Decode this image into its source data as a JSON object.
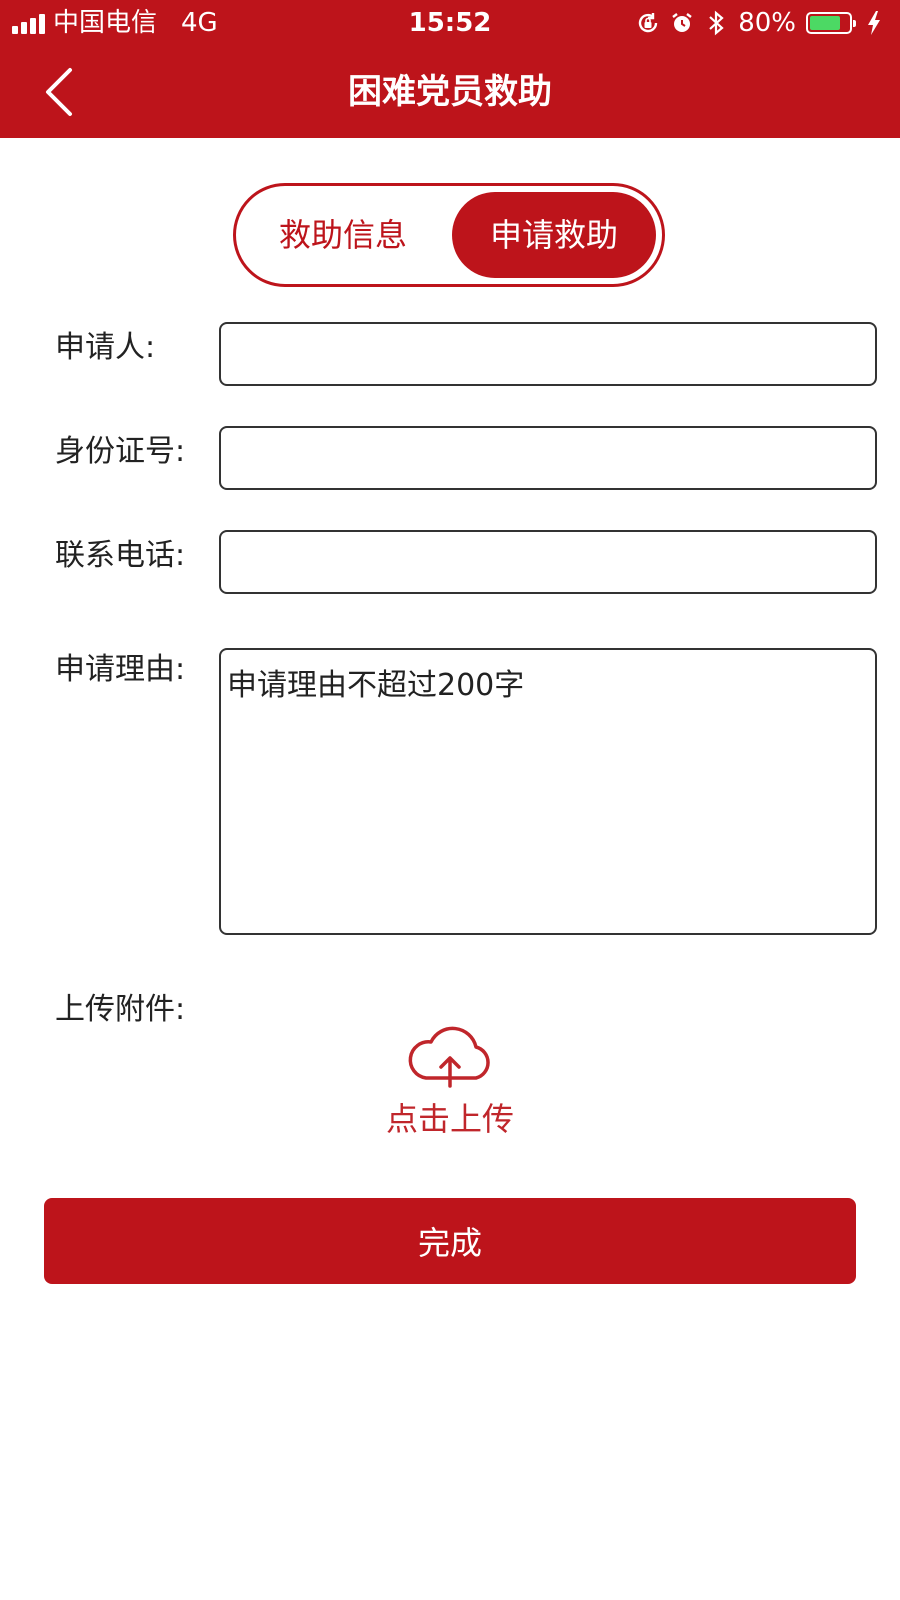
{
  "status_bar": {
    "carrier": "中国电信",
    "network": "4G",
    "time": "15:52",
    "battery": "80%",
    "battery_level": 0.8,
    "icons": [
      "signal-icon",
      "rotation-lock-icon",
      "alarm-icon",
      "bluetooth-icon",
      "battery-icon",
      "charging-icon"
    ]
  },
  "nav": {
    "title": "困难党员救助",
    "back_icon": "chevron-left-icon"
  },
  "segment": {
    "tabs": [
      {
        "label": "救助信息",
        "active": false
      },
      {
        "label": "申请救助",
        "active": true
      }
    ]
  },
  "form": {
    "applicant": {
      "label": "申请人:",
      "value": "",
      "placeholder": ""
    },
    "id_number": {
      "label": "身份证号:",
      "value": "",
      "placeholder": ""
    },
    "phone": {
      "label": "联系电话:",
      "value": "",
      "placeholder": ""
    },
    "reason": {
      "label": "申请理由:",
      "value": "",
      "placeholder": "申请理由不超过200字"
    },
    "attachment": {
      "label": "上传附件:",
      "upload_label": "点击上传",
      "icon": "cloud-upload-icon"
    }
  },
  "submit": {
    "label": "完成"
  },
  "colors": {
    "brand": "#BD141B",
    "upload_text": "#C0262B",
    "battery_fill": "#4CD964"
  }
}
